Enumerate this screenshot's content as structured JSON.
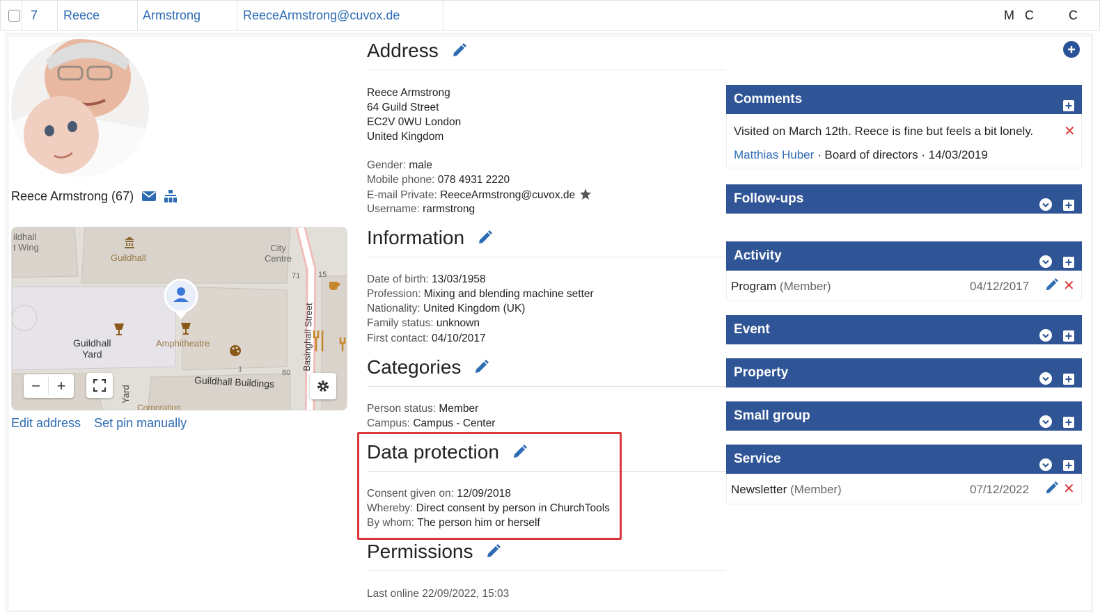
{
  "row": {
    "number": "7",
    "first_name": "Reece",
    "last_name": "Armstrong",
    "email": "ReeceArmstrong@cuvox.de",
    "col_m": "M",
    "col_c1": "C",
    "col_c2": "C"
  },
  "profile": {
    "name_age": "Reece Armstrong (67)"
  },
  "map": {
    "labels": {
      "guildhall_top": "Guildhall",
      "guildhall_yard": "Guildhall\nYard",
      "amphitheatre": "Amphitheatre",
      "guildhall_buildings": "Guildhall Buildings",
      "basinghall_street": "Basinghall Street",
      "city_centre": "City\nCentre",
      "idhall": "ildhall\nt Wing",
      "yard": "Yard",
      "corporation": "Corporation",
      "n71": "71",
      "n15": "15",
      "n80": "80",
      "n1": "1"
    },
    "zoom_out": "−",
    "zoom_in": "+"
  },
  "map_links": {
    "edit_address": "Edit address",
    "set_pin": "Set pin manually"
  },
  "address": {
    "title": "Address",
    "lines": [
      "Reece Armstrong",
      "64 Guild Street",
      "EC2V 0WU London",
      "United Kingdom"
    ],
    "gender_label": "Gender:",
    "gender": "male",
    "mobile_label": "Mobile phone:",
    "mobile": "078 4931 2220",
    "email_label": "E-mail Private:",
    "email": "ReeceArmstrong@cuvox.de",
    "username_label": "Username:",
    "username": "rarmstrong"
  },
  "information": {
    "title": "Information",
    "dob_label": "Date of birth:",
    "dob": "13/03/1958",
    "profession_label": "Profession:",
    "profession": "Mixing and blending machine setter",
    "nationality_label": "Nationality:",
    "nationality": "United Kingdom (UK)",
    "family_label": "Family status:",
    "family": "unknown",
    "contact_label": "First contact:",
    "contact": "04/10/2017"
  },
  "categories": {
    "title": "Categories",
    "status_label": "Person status:",
    "status": "Member",
    "campus_label": "Campus:",
    "campus": "Campus - Center"
  },
  "data_protection": {
    "title": "Data protection",
    "consent_label": "Consent given on:",
    "consent": "12/09/2018",
    "whereby_label": "Whereby:",
    "whereby": "Direct consent by person in ChurchTools",
    "bywhom_label": "By whom:",
    "bywhom": "The person him or herself"
  },
  "permissions": {
    "title": "Permissions",
    "last_online": "Last online 22/09/2022, 15:03"
  },
  "comments": {
    "title": "Comments",
    "text": "Visited on March 12th. Reece is fine but feels a bit lonely.",
    "author": "Matthias Huber",
    "sep": "·",
    "group": "Board of directors",
    "date": "14/03/2019"
  },
  "followups": {
    "title": "Follow-ups"
  },
  "activity": {
    "title": "Activity",
    "item": "Program",
    "role": "(Member)",
    "date": "04/12/2017"
  },
  "event": {
    "title": "Event"
  },
  "property": {
    "title": "Property"
  },
  "smallgroup": {
    "title": "Small group"
  },
  "service": {
    "title": "Service",
    "item": "Newsletter",
    "role": "(Member)",
    "date": "07/12/2022"
  },
  "colors": {
    "link": "#2d6bb3",
    "header": "#2f5596",
    "highlight": "#d9373a",
    "delete": "#d9373a"
  }
}
